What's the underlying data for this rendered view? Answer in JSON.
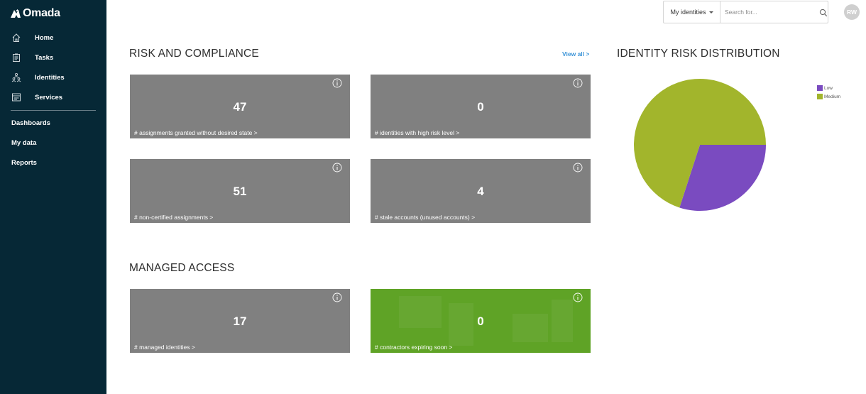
{
  "sidebar": {
    "logo_text": "Omada",
    "items": [
      {
        "label": "Home",
        "icon": "home-icon"
      },
      {
        "label": "Tasks",
        "icon": "tasks-icon"
      },
      {
        "label": "Identities",
        "icon": "identities-icon"
      },
      {
        "label": "Services",
        "icon": "services-icon"
      }
    ],
    "plain_items": [
      {
        "label": "Dashboards"
      },
      {
        "label": "My data"
      },
      {
        "label": "Reports"
      }
    ]
  },
  "topbar": {
    "scope_selector": "My identities",
    "search_placeholder": "Search for...",
    "avatar_initials": "RW"
  },
  "risk": {
    "title": "RISK AND COMPLIANCE",
    "view_all": "View all >",
    "tiles": [
      {
        "value": "47",
        "caption": "# assignments granted without desired state >"
      },
      {
        "value": "0",
        "caption": "# identities with high risk level >"
      },
      {
        "value": "51",
        "caption": "# non-certified assignments >"
      },
      {
        "value": "4",
        "caption": "# stale accounts (unused accounts) >"
      }
    ]
  },
  "managed": {
    "title": "MANAGED ACCESS",
    "tiles": [
      {
        "value": "17",
        "caption": "# managed identities >"
      },
      {
        "value": "0",
        "caption": "# contractors expiring soon >"
      }
    ]
  },
  "chart_data": {
    "type": "pie",
    "title": "IDENTITY RISK DISTRIBUTION",
    "slices": [
      {
        "label": "Low",
        "value": 30,
        "color": "#7a4bc0"
      },
      {
        "label": "Medium",
        "value": 70,
        "color": "#a2b52c"
      }
    ],
    "legend_position": "top-right"
  },
  "colors": {
    "sidebar_bg": "#062836",
    "tile_gray": "#808080",
    "tile_green": "#5fa326",
    "link_blue": "#3d95d8"
  }
}
